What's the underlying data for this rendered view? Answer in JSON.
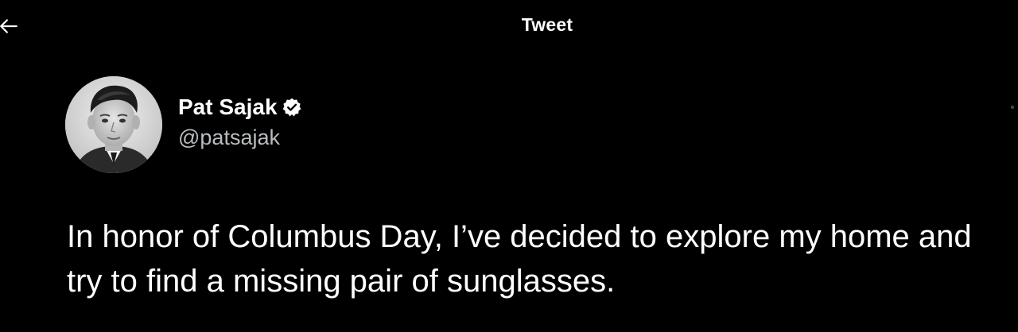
{
  "header": {
    "title": "Tweet",
    "back_icon": "arrow-left-icon"
  },
  "tweet": {
    "author": {
      "display_name": "Pat Sajak",
      "handle": "@patsajak",
      "verified": true,
      "verified_icon": "verified-badge-icon",
      "avatar": "black-and-white portrait photo"
    },
    "text": "In honor of Columbus Day, I’ve decided to explore my home and try to find a missing pair of sunglasses."
  },
  "colors": {
    "background": "#000000",
    "text_primary": "#ffffff",
    "text_secondary": "#b9bcbf"
  }
}
